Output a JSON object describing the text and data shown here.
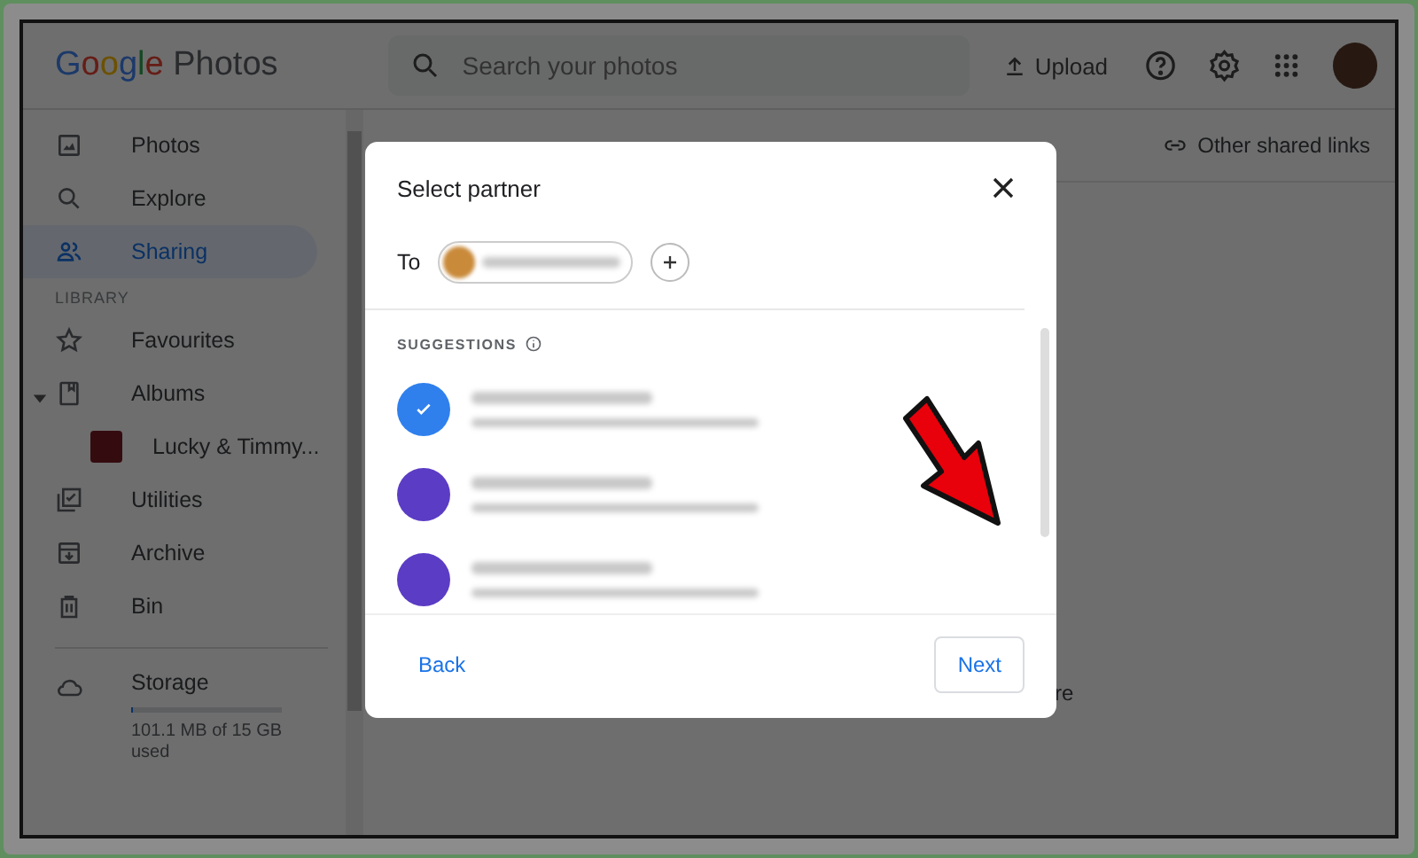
{
  "header": {
    "logo": "Google",
    "product": "Photos",
    "search": {
      "placeholder": "Search your photos"
    },
    "upload": "Upload"
  },
  "sidebar": {
    "items": [
      {
        "kind": "photos",
        "label": "Photos",
        "selected": false
      },
      {
        "kind": "explore",
        "label": "Explore",
        "selected": false
      },
      {
        "kind": "sharing",
        "label": "Sharing",
        "selected": true
      }
    ],
    "section": "LIBRARY",
    "library": [
      {
        "kind": "favourites",
        "label": "Favourites",
        "selected": false
      },
      {
        "kind": "albums",
        "label": "Albums",
        "selected": false,
        "expanded": true,
        "children": [
          {
            "label": "Lucky & Timmy..."
          }
        ]
      },
      {
        "kind": "utilities",
        "label": "Utilities",
        "selected": false
      },
      {
        "kind": "archive",
        "label": "Archive",
        "selected": false
      },
      {
        "kind": "bin",
        "label": "Bin",
        "selected": false
      }
    ],
    "storage": {
      "label": "Storage",
      "level": 0.01,
      "usage": "101.1 MB of 15 GB used"
    }
  },
  "main": {
    "link": "Other shared links",
    "fragment": "re"
  },
  "dialog": {
    "title": "Select partner",
    "to_label": "To",
    "suggestions_heading": "SUGGESTIONS",
    "suggestions": [
      {
        "selected": true,
        "color": "#2f80ed"
      },
      {
        "selected": false,
        "color": "#5b3cc4"
      },
      {
        "selected": false,
        "color": "#5b3cc4"
      }
    ],
    "back": "Back",
    "next": "Next"
  }
}
